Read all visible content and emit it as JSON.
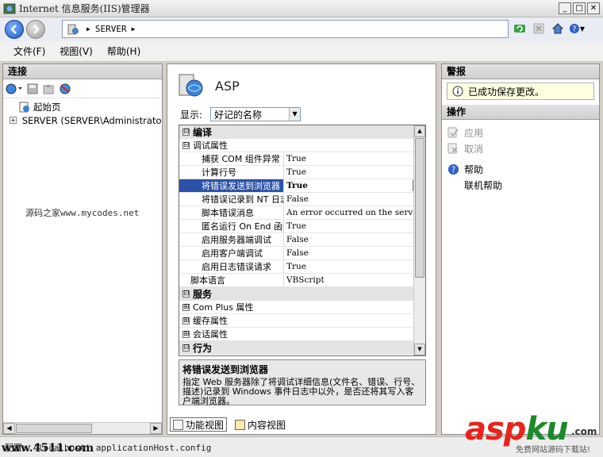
{
  "window": {
    "title": "Internet 信息服务(IIS)管理器",
    "controls": [
      "_",
      "□",
      "✕"
    ]
  },
  "address": {
    "path": "SERVER",
    "separator_glyph": "▶"
  },
  "menu": [
    "文件(F)",
    "视图(V)",
    "帮助(H)"
  ],
  "left_panel": {
    "title": "连接",
    "tree": [
      {
        "label": "起始页",
        "expander": ""
      },
      {
        "label": "SERVER (SERVER\\Administrator)",
        "expander": "+"
      }
    ],
    "watermark": "源码之家www.mycodes.net"
  },
  "center_panel": {
    "feature_title": "ASP",
    "display_label": "显示:",
    "display_value": "好记的名称",
    "grid": [
      {
        "type": "cat",
        "expander": "⊟",
        "name": "编译",
        "value": ""
      },
      {
        "type": "sub",
        "expander": "⊟",
        "name": "调试属性",
        "value": ""
      },
      {
        "type": "prop",
        "indent": 2,
        "name": "捕获 COM 组件异常",
        "value": "True"
      },
      {
        "type": "prop",
        "indent": 2,
        "name": "计算行号",
        "value": "True"
      },
      {
        "type": "prop",
        "indent": 2,
        "name": "将错误发送到浏览器",
        "value": "True",
        "selected": true
      },
      {
        "type": "prop",
        "indent": 2,
        "name": "将错误记录到 NT 日志",
        "value": "False"
      },
      {
        "type": "prop",
        "indent": 2,
        "name": "脚本错误消息",
        "value": "An error occurred on the server"
      },
      {
        "type": "prop",
        "indent": 2,
        "name": "匿名运行 On End 函数",
        "value": "True"
      },
      {
        "type": "prop",
        "indent": 2,
        "name": "启用服务器端调试",
        "value": "False"
      },
      {
        "type": "prop",
        "indent": 2,
        "name": "启用客户端调试",
        "value": "False"
      },
      {
        "type": "prop",
        "indent": 2,
        "name": "启用日志错误请求",
        "value": "True"
      },
      {
        "type": "prop",
        "indent": 1,
        "name": "脚本语言",
        "value": "VBScript"
      },
      {
        "type": "cat",
        "expander": "⊟",
        "name": "服务",
        "value": ""
      },
      {
        "type": "sub",
        "expander": "⊞",
        "name": "Com Plus 属性",
        "value": ""
      },
      {
        "type": "sub",
        "expander": "⊞",
        "name": "缓存属性",
        "value": ""
      },
      {
        "type": "sub",
        "expander": "⊞",
        "name": "会话属性",
        "value": ""
      },
      {
        "type": "cat",
        "expander": "⊟",
        "name": "行为",
        "value": ""
      }
    ],
    "description": {
      "title": "将错误发送到浏览器",
      "text": "指定 Web 服务器除了将调试详细信息(文件名、错误、行号、描述)记录到 Windows 事件日志中以外，是否还将其写入客户端浏览器。"
    },
    "view_tabs": [
      "功能视图",
      "内容视图"
    ]
  },
  "right_panel": {
    "alerts_title": "警报",
    "alert_text": "已成功保存更改。",
    "actions_title": "操作",
    "actions": [
      {
        "label": "应用",
        "disabled": true,
        "icon": "apply-icon"
      },
      {
        "label": "取消",
        "disabled": true,
        "icon": "cancel-icon"
      },
      {
        "label": "帮助",
        "disabled": false,
        "icon": "help-icon"
      },
      {
        "label": "联机帮助",
        "disabled": false,
        "icon": ""
      }
    ]
  },
  "statusbar": {
    "text": "配置: 'localhost' applicationHost.config",
    "watermark": "www.4511.com"
  },
  "brand": {
    "part1": "asp",
    "part2": "ku",
    "suffix": ".com",
    "subtitle": "免费网站源码下载站!"
  }
}
